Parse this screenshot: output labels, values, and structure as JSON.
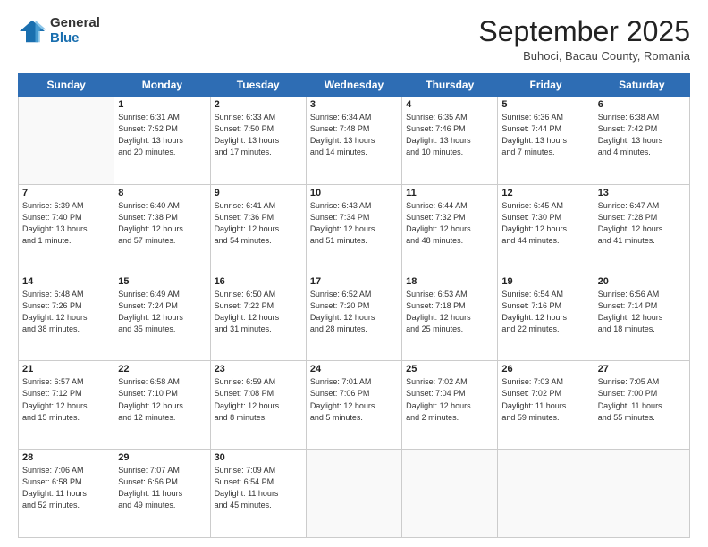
{
  "header": {
    "logo": {
      "general": "General",
      "blue": "Blue"
    },
    "title": "September 2025",
    "subtitle": "Buhoci, Bacau County, Romania"
  },
  "calendar": {
    "days_of_week": [
      "Sunday",
      "Monday",
      "Tuesday",
      "Wednesday",
      "Thursday",
      "Friday",
      "Saturday"
    ],
    "weeks": [
      [
        {
          "day": "",
          "info": ""
        },
        {
          "day": "1",
          "info": "Sunrise: 6:31 AM\nSunset: 7:52 PM\nDaylight: 13 hours\nand 20 minutes."
        },
        {
          "day": "2",
          "info": "Sunrise: 6:33 AM\nSunset: 7:50 PM\nDaylight: 13 hours\nand 17 minutes."
        },
        {
          "day": "3",
          "info": "Sunrise: 6:34 AM\nSunset: 7:48 PM\nDaylight: 13 hours\nand 14 minutes."
        },
        {
          "day": "4",
          "info": "Sunrise: 6:35 AM\nSunset: 7:46 PM\nDaylight: 13 hours\nand 10 minutes."
        },
        {
          "day": "5",
          "info": "Sunrise: 6:36 AM\nSunset: 7:44 PM\nDaylight: 13 hours\nand 7 minutes."
        },
        {
          "day": "6",
          "info": "Sunrise: 6:38 AM\nSunset: 7:42 PM\nDaylight: 13 hours\nand 4 minutes."
        }
      ],
      [
        {
          "day": "7",
          "info": "Sunrise: 6:39 AM\nSunset: 7:40 PM\nDaylight: 13 hours\nand 1 minute."
        },
        {
          "day": "8",
          "info": "Sunrise: 6:40 AM\nSunset: 7:38 PM\nDaylight: 12 hours\nand 57 minutes."
        },
        {
          "day": "9",
          "info": "Sunrise: 6:41 AM\nSunset: 7:36 PM\nDaylight: 12 hours\nand 54 minutes."
        },
        {
          "day": "10",
          "info": "Sunrise: 6:43 AM\nSunset: 7:34 PM\nDaylight: 12 hours\nand 51 minutes."
        },
        {
          "day": "11",
          "info": "Sunrise: 6:44 AM\nSunset: 7:32 PM\nDaylight: 12 hours\nand 48 minutes."
        },
        {
          "day": "12",
          "info": "Sunrise: 6:45 AM\nSunset: 7:30 PM\nDaylight: 12 hours\nand 44 minutes."
        },
        {
          "day": "13",
          "info": "Sunrise: 6:47 AM\nSunset: 7:28 PM\nDaylight: 12 hours\nand 41 minutes."
        }
      ],
      [
        {
          "day": "14",
          "info": "Sunrise: 6:48 AM\nSunset: 7:26 PM\nDaylight: 12 hours\nand 38 minutes."
        },
        {
          "day": "15",
          "info": "Sunrise: 6:49 AM\nSunset: 7:24 PM\nDaylight: 12 hours\nand 35 minutes."
        },
        {
          "day": "16",
          "info": "Sunrise: 6:50 AM\nSunset: 7:22 PM\nDaylight: 12 hours\nand 31 minutes."
        },
        {
          "day": "17",
          "info": "Sunrise: 6:52 AM\nSunset: 7:20 PM\nDaylight: 12 hours\nand 28 minutes."
        },
        {
          "day": "18",
          "info": "Sunrise: 6:53 AM\nSunset: 7:18 PM\nDaylight: 12 hours\nand 25 minutes."
        },
        {
          "day": "19",
          "info": "Sunrise: 6:54 AM\nSunset: 7:16 PM\nDaylight: 12 hours\nand 22 minutes."
        },
        {
          "day": "20",
          "info": "Sunrise: 6:56 AM\nSunset: 7:14 PM\nDaylight: 12 hours\nand 18 minutes."
        }
      ],
      [
        {
          "day": "21",
          "info": "Sunrise: 6:57 AM\nSunset: 7:12 PM\nDaylight: 12 hours\nand 15 minutes."
        },
        {
          "day": "22",
          "info": "Sunrise: 6:58 AM\nSunset: 7:10 PM\nDaylight: 12 hours\nand 12 minutes."
        },
        {
          "day": "23",
          "info": "Sunrise: 6:59 AM\nSunset: 7:08 PM\nDaylight: 12 hours\nand 8 minutes."
        },
        {
          "day": "24",
          "info": "Sunrise: 7:01 AM\nSunset: 7:06 PM\nDaylight: 12 hours\nand 5 minutes."
        },
        {
          "day": "25",
          "info": "Sunrise: 7:02 AM\nSunset: 7:04 PM\nDaylight: 12 hours\nand 2 minutes."
        },
        {
          "day": "26",
          "info": "Sunrise: 7:03 AM\nSunset: 7:02 PM\nDaylight: 11 hours\nand 59 minutes."
        },
        {
          "day": "27",
          "info": "Sunrise: 7:05 AM\nSunset: 7:00 PM\nDaylight: 11 hours\nand 55 minutes."
        }
      ],
      [
        {
          "day": "28",
          "info": "Sunrise: 7:06 AM\nSunset: 6:58 PM\nDaylight: 11 hours\nand 52 minutes."
        },
        {
          "day": "29",
          "info": "Sunrise: 7:07 AM\nSunset: 6:56 PM\nDaylight: 11 hours\nand 49 minutes."
        },
        {
          "day": "30",
          "info": "Sunrise: 7:09 AM\nSunset: 6:54 PM\nDaylight: 11 hours\nand 45 minutes."
        },
        {
          "day": "",
          "info": ""
        },
        {
          "day": "",
          "info": ""
        },
        {
          "day": "",
          "info": ""
        },
        {
          "day": "",
          "info": ""
        }
      ]
    ]
  }
}
